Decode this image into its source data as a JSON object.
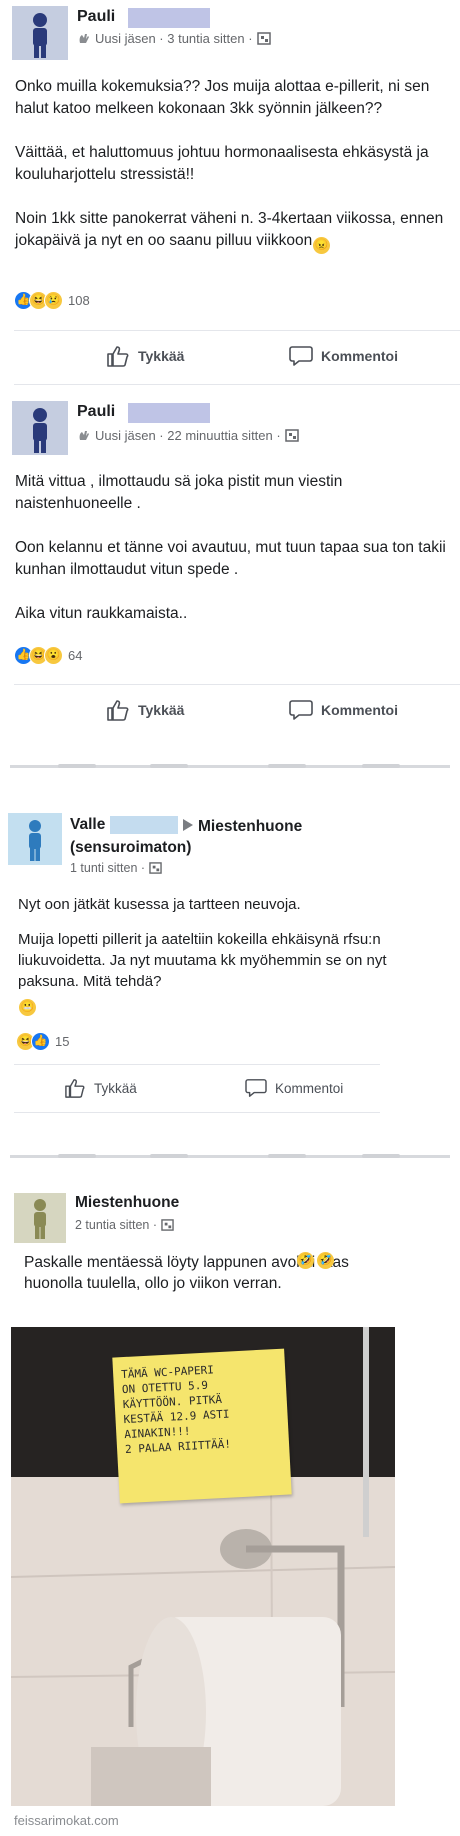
{
  "posts": [
    {
      "author": "Pauli",
      "meta": "Uusi jäsen · 3 tuntia sitten ·",
      "paragraphs": [
        "Onko muilla kokemuksia?? Jos muija alottaa e-pillerit, ni sen halut katoo melkeen kokonaan 3kk syönnin jälkeen??",
        "Väittää, et haluttomuus johtuu hormonaalisesta ehkäsystä ja kouluharjottelu stressistä!!",
        "Noin 1kk sitte panokerrat väheni n. 3-4kertaan viikossa, ennen jokapäivä ja nyt en oo saanu pilluu viikkoon"
      ],
      "reaction_count": "108",
      "like_label": "Tykkää",
      "comment_label": "Kommentoi"
    },
    {
      "author": "Pauli",
      "meta": "Uusi jäsen · 22 minuuttia sitten ·",
      "paragraphs": [
        "Mitä vittua , ilmottaudu sä joka pistit mun viestin naistenhuoneelle .",
        "Oon kelannu et tänne voi avautuu, mut tuun tapaa sua ton takii kunhan ilmottaudut vitun spede .",
        "Aika vitun raukkamaista.."
      ],
      "reaction_count": "64",
      "like_label": "Tykkää",
      "comment_label": "Kommentoi"
    },
    {
      "author": "Valle",
      "group": "Miestenhuone (sensuroimaton)",
      "meta": "1 tunti sitten ·",
      "paragraphs": [
        "Nyt oon jätkät kusessa ja tartteen neuvoja.",
        "Muija lopetti pillerit ja aateltiin kokeilla ehkäisynä rfsu:n liukuvoidetta. Ja nyt muutama kk myöhemmin se on nyt paksuna. Mitä tehdä?"
      ],
      "reaction_count": "15",
      "like_label": "Tykkää",
      "comment_label": "Kommentoi"
    },
    {
      "author": "Miestenhuone",
      "meta": "2 tuntia sitten ·",
      "paragraphs": [
        "Paskalle mentäessä löyty lappunen avokki taas huonolla tuulella, ollo jo viikon verran."
      ],
      "note_lines": [
        "TÄMÄ WC-PAPERI",
        "ON OTETTU 5.9",
        "KÄYTTÖÖN. PITKÄ",
        "KESTÄÄ 12.9 ASTI",
        "AINAKIN!!!",
        "2 PALAA RIITTÄÄ!"
      ]
    }
  ],
  "watermark": "feissarimokat.com",
  "colors": {
    "like_blue": "#1877f2",
    "emoji_yellow": "#f7c83f",
    "text": "#1c1e21",
    "meta": "#65676b"
  }
}
